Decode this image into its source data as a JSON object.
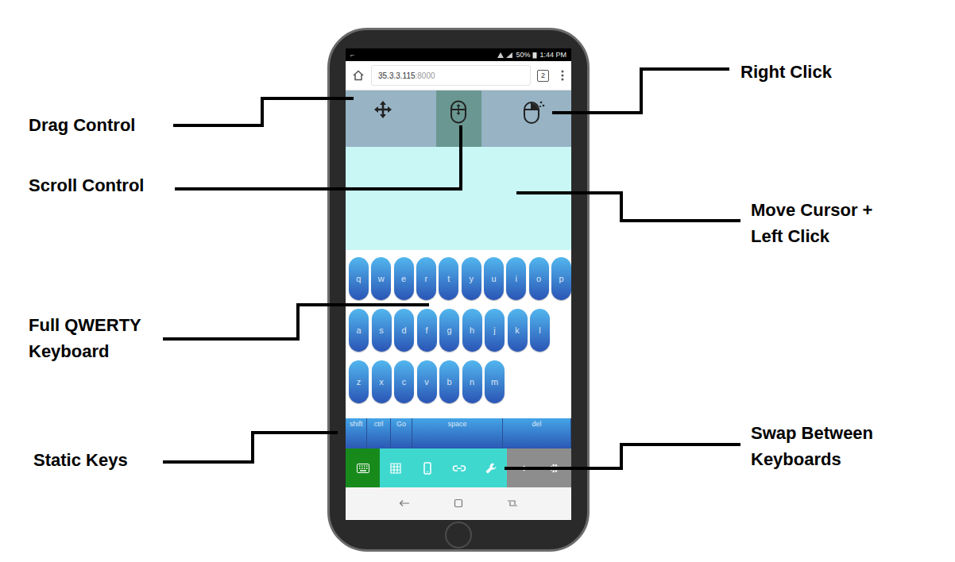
{
  "callouts": [
    {
      "lines": [
        "Drag Control"
      ]
    },
    {
      "lines": [
        "Scroll Control"
      ]
    },
    {
      "lines": [
        "Full QWERTY",
        "Keyboard"
      ]
    },
    {
      "lines": [
        "Static Keys"
      ]
    },
    {
      "lines": [
        "Right Click"
      ]
    },
    {
      "lines": [
        "Move Cursor +",
        "Left Click"
      ]
    },
    {
      "lines": [
        "Swap Between",
        "Keyboards"
      ]
    }
  ],
  "phone": {
    "status_bar": {
      "battery": "50%",
      "time": "1:44 PM"
    },
    "browser": {
      "host": "35.3.3.115",
      "port": ":8000",
      "tab_count": "2"
    },
    "mouse_tools": [
      {
        "kind": "drag",
        "selected": false
      },
      {
        "kind": "scroll",
        "selected": true
      },
      {
        "kind": "right-click",
        "selected": false
      }
    ],
    "keyboard_rows": [
      [
        "q",
        "w",
        "e",
        "r",
        "t",
        "y",
        "u",
        "i",
        "o",
        "p"
      ],
      [
        "a",
        "s",
        "d",
        "f",
        "g",
        "h",
        "j",
        "k",
        "l"
      ],
      [
        "z",
        "x",
        "c",
        "v",
        "b",
        "n",
        "m"
      ]
    ],
    "static_keys": [
      "shift",
      "ctrl",
      "Go",
      "space",
      "del"
    ],
    "keyboard_tabs": [
      {
        "kind": "keyboard",
        "selected": true
      },
      {
        "kind": "grid",
        "selected": false
      },
      {
        "kind": "phone",
        "selected": false
      },
      {
        "kind": "link",
        "selected": false
      },
      {
        "kind": "wrench",
        "selected": false
      }
    ],
    "extra_tools": [
      {
        "kind": "arrow"
      },
      {
        "kind": "gear"
      }
    ]
  }
}
